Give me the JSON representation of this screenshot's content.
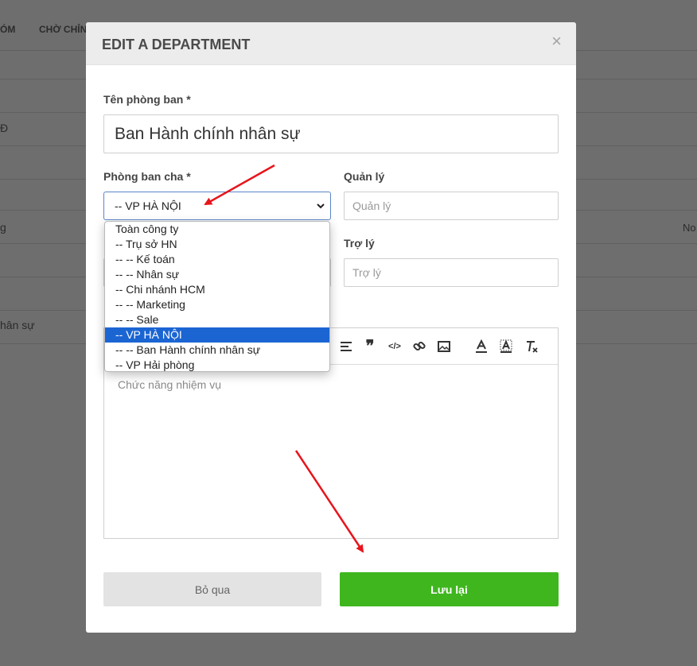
{
  "background": {
    "tabs": [
      "ÓM",
      "CHỜ CHỈN"
    ],
    "texts": [
      "Đ",
      "g",
      "hân sự",
      "No"
    ]
  },
  "modal": {
    "title": "EDIT A DEPARTMENT",
    "close_icon": "close-icon",
    "fields": {
      "name": {
        "label": "Tên phòng ban *",
        "value": "Ban Hành chính nhân sự"
      },
      "parent": {
        "label": "Phòng ban cha *",
        "value": "-- VP HÀ NỘI"
      },
      "manager": {
        "label": "Quản lý",
        "placeholder": "Quản lý"
      },
      "assistant": {
        "label": "Trợ lý",
        "placeholder": "Trợ lý"
      },
      "description": {
        "placeholder": "Chức năng nhiệm vụ"
      }
    },
    "dropdown_options": [
      "Toàn công ty",
      "-- Trụ sở HN",
      "-- -- Kế toán",
      "-- -- Nhân sự",
      "-- Chi nhánh HCM",
      "-- -- Marketing",
      "-- -- Sale",
      "-- VP HÀ NỘI",
      "-- -- Ban Hành chính nhân sự",
      "-- VP Hải phòng"
    ],
    "selected_option_index": 7,
    "toolbar_icons": [
      "align-left-icon",
      "quote-icon",
      "code-icon",
      "link-icon",
      "image-icon",
      "font-color-icon",
      "background-color-icon",
      "clear-format-icon"
    ],
    "buttons": {
      "cancel": "Bỏ qua",
      "save": "Lưu lại"
    }
  },
  "colors": {
    "save": "#3fb61e",
    "selected": "#1b65d3",
    "arrow": "#e8141b"
  }
}
